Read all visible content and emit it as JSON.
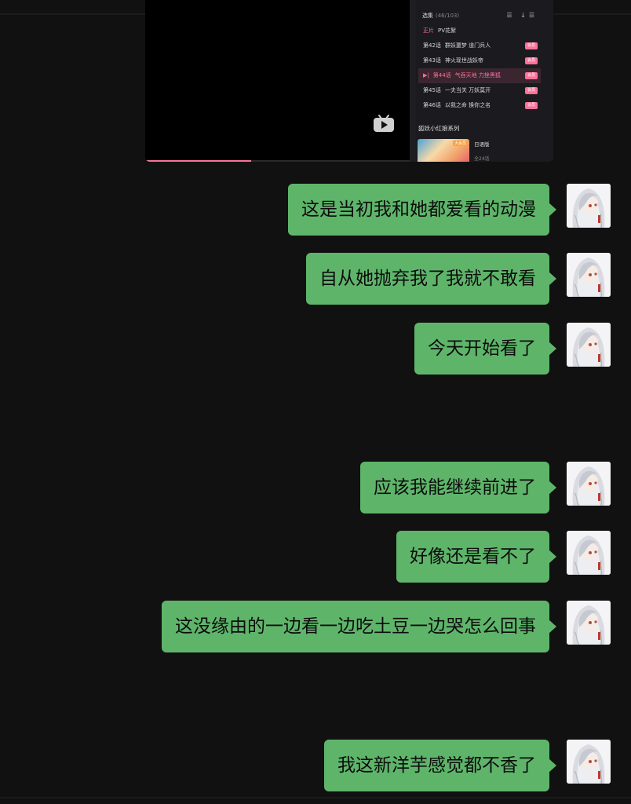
{
  "shared_screenshot": {
    "playback_progress": 0.4,
    "episodes_header": "选集",
    "episodes_count": "(46/103)",
    "episodes_tools": "☰ ↓☰",
    "episodes": [
      {
        "no": "正片",
        "title": "PV花絮",
        "vip": "",
        "active": false
      },
      {
        "no": "第42话",
        "title": "群妖噩梦 道门兵人",
        "vip": "会员",
        "active": false
      },
      {
        "no": "第43话",
        "title": "神火现世战妖帝",
        "vip": "会员",
        "active": false
      },
      {
        "no": "第44话",
        "title": "气吞天地 力挫黑狐",
        "vip": "会员",
        "active": true,
        "playing_icon": "▶|"
      },
      {
        "no": "第45话",
        "title": "一夫当关 万妖莫开",
        "vip": "会员",
        "active": false
      },
      {
        "no": "第46话",
        "title": "以我之命 换你之名",
        "vip": "会员",
        "active": false
      }
    ],
    "series_title": "狐妖小红娘系列",
    "series_badge": "大会员",
    "series_version": "日语版",
    "series_count": "全24话"
  },
  "messages": [
    {
      "text": "这是当初我和她都爱看的动漫"
    },
    {
      "text": "自从她抛弃我了我就不敢看"
    },
    {
      "text": "今天开始看了"
    },
    {
      "text": "应该我能继续前进了"
    },
    {
      "text": "好像还是看不了"
    },
    {
      "text": "这没缘由的一边看一边吃土豆一边哭怎么回事"
    },
    {
      "text": "我这新洋芋感觉都不香了"
    }
  ],
  "colors": {
    "bubble": "#5eb56a",
    "background": "#111111",
    "accent": "#fb7299"
  }
}
